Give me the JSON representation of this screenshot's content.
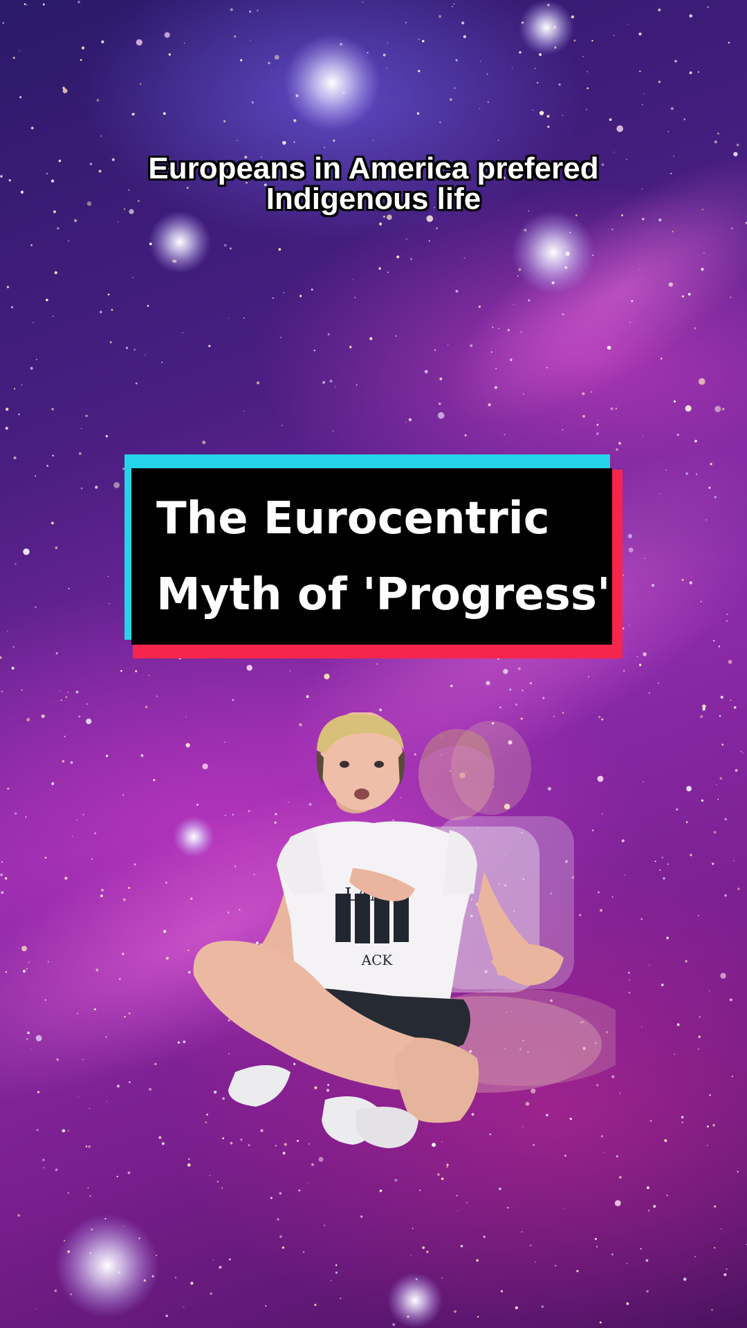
{
  "caption": {
    "line1": "Europeans in America prefered",
    "line2": "Indigenous life"
  },
  "title_card": {
    "line1": "The Eurocentric",
    "line2": "Myth of 'Progress'"
  },
  "presenter": {
    "shirt_text_top": "LAND",
    "shirt_text_bottom": "ACK"
  },
  "colors": {
    "card_cyan": "#25d4e8",
    "card_red": "#f4264e",
    "card_fill": "#000000",
    "caption_text": "#ffffff"
  }
}
